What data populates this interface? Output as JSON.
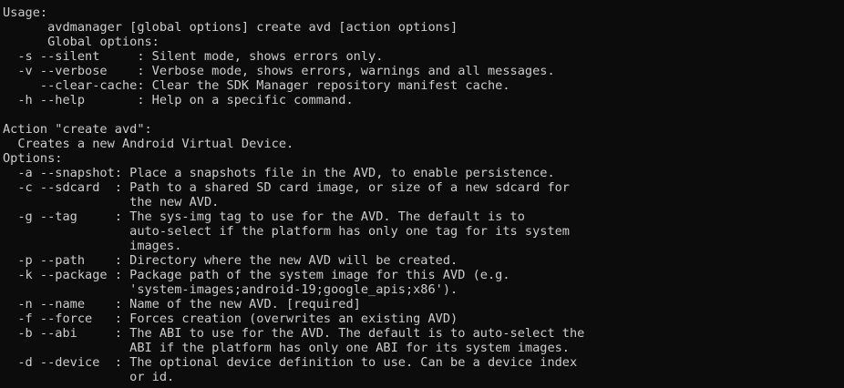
{
  "console": {
    "lines": [
      "Usage:",
      "      avdmanager [global options] create avd [action options]",
      "      Global options:",
      "  -s --silent     : Silent mode, shows errors only.",
      "  -v --verbose    : Verbose mode, shows errors, warnings and all messages.",
      "     --clear-cache: Clear the SDK Manager repository manifest cache.",
      "  -h --help       : Help on a specific command.",
      "",
      "Action \"create avd\":",
      "  Creates a new Android Virtual Device.",
      "Options:",
      "  -a --snapshot: Place a snapshots file in the AVD, to enable persistence.",
      "  -c --sdcard  : Path to a shared SD card image, or size of a new sdcard for",
      "                 the new AVD.",
      "  -g --tag     : The sys-img tag to use for the AVD. The default is to",
      "                 auto-select if the platform has only one tag for its system",
      "                 images.",
      "  -p --path    : Directory where the new AVD will be created.",
      "  -k --package : Package path of the system image for this AVD (e.g.",
      "                 'system-images;android-19;google_apis;x86').",
      "  -n --name    : Name of the new AVD. [required]",
      "  -f --force   : Forces creation (overwrites an existing AVD)",
      "  -b --abi     : The ABI to use for the AVD. The default is to auto-select the",
      "                 ABI if the platform has only one ABI for its system images.",
      "  -d --device  : The optional device definition to use. Can be a device index",
      "                 or id."
    ]
  }
}
